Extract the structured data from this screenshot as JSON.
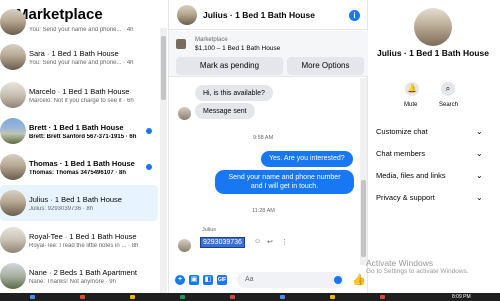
{
  "left_panel": {
    "title": "Marketplace",
    "back_icon": "arrow-left-icon",
    "conversations": [
      {
        "name": "",
        "preview": "You: Send your name and phone... · 4h",
        "unread": false
      },
      {
        "name": "Sara · 1 Bed 1 Bath House",
        "preview": "You: Send your name and phone... · 4h",
        "unread": false
      },
      {
        "name": "Marcelo · 1 Bed 1 Bath House",
        "preview": "Marcelo: Not if you charge to see it · 6h",
        "unread": false
      },
      {
        "name": "Brett · 1 Bed 1 Bath House",
        "preview": "Brett: Brett Sanford 567-371-1915 · 6h",
        "unread": true
      },
      {
        "name": "Thomas · 1 Bed 1 Bath House",
        "preview": "Thomas: Thomas 3475496107 · 8h",
        "unread": true
      },
      {
        "name": "Julius · 1 Bed 1 Bath House",
        "preview": "Julius: 9293039736 · 8h",
        "unread": false,
        "active": true
      },
      {
        "name": "Royal-Tee · 1 Bed 1 Bath House",
        "preview": "Royal-Tee: I read the little notes in ... · 8h",
        "unread": false
      },
      {
        "name": "Nane · 2 Beds 1 Bath Apartment",
        "preview": "Nane: Thanks! Not anymore · 9h",
        "unread": false
      }
    ]
  },
  "chat": {
    "title": "Julius · 1 Bed 1 Bath House",
    "listing_label": "Marketplace",
    "listing_price": "$1,100 – 1 Bed 1 Bath House",
    "mark_pending": "Mark as pending",
    "more_options": "More Options",
    "msg_in_1": "Hi, is this available?",
    "msg_in_2": "Message sent",
    "time_1": "9:58 AM",
    "msg_out_1": "Yes. Are you interested?",
    "msg_out_2": "Send your name and phone number and I will get in touch.",
    "time_2": "11:28 AM",
    "sender": "Julius",
    "phone_msg": "9293039736",
    "composer_placeholder": "Aa"
  },
  "right_panel": {
    "name": "Julius · 1 Bed 1 Bath House",
    "mute_label": "Mute",
    "search_label": "Search",
    "menu": [
      "Customize chat",
      "Chat members",
      "Media, files and links",
      "Privacy & support"
    ]
  },
  "watermark": {
    "line1": "Activate Windows",
    "line2": "Go to Settings to activate Windows."
  },
  "taskbar": {
    "time": "8:09 PM"
  },
  "colors": {
    "accent": "#1877f2",
    "bubble_in": "#e4e6eb",
    "active_row": "#e7f3ff"
  }
}
